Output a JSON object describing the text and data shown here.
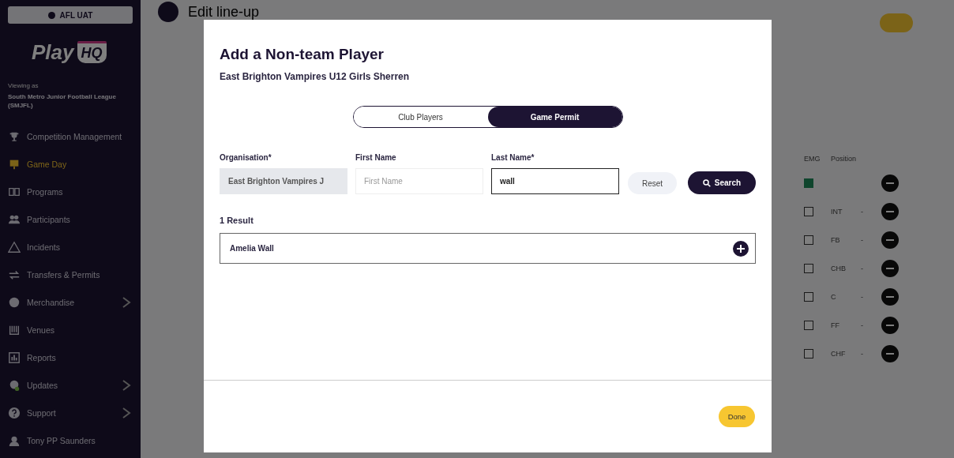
{
  "sidebar": {
    "environment": "AFL UAT",
    "logo_word": "Play",
    "logo_badge": "HQ",
    "viewing_label": "Viewing as",
    "organisation": "South Metro Junior Football League (SMJFL)",
    "items": [
      {
        "label": "Competition Management",
        "selected": false,
        "has_submenu": false
      },
      {
        "label": "Game Day",
        "selected": true,
        "has_submenu": false
      },
      {
        "label": "Programs",
        "selected": false,
        "has_submenu": false
      },
      {
        "label": "Participants",
        "selected": false,
        "has_submenu": false
      },
      {
        "label": "Incidents",
        "selected": false,
        "has_submenu": false
      },
      {
        "label": "Transfers & Permits",
        "selected": false,
        "has_submenu": false
      },
      {
        "label": "Merchandise",
        "selected": false,
        "has_submenu": true
      },
      {
        "label": "Venues",
        "selected": false,
        "has_submenu": false
      },
      {
        "label": "Reports",
        "selected": false,
        "has_submenu": false
      },
      {
        "label": "Updates",
        "selected": false,
        "has_submenu": true
      },
      {
        "label": "Support",
        "selected": false,
        "has_submenu": true
      },
      {
        "label": "Tony PP Saunders",
        "selected": false,
        "has_submenu": false
      }
    ]
  },
  "page": {
    "title": "Edit line-up",
    "lineup": {
      "columns": [
        "EMG",
        "Position"
      ],
      "rows": [
        {
          "emergency": true,
          "dash": ""
        },
        {
          "emergency": false,
          "position": "INT",
          "dash": "-"
        },
        {
          "emergency": false,
          "position": "FB",
          "dash": "-"
        },
        {
          "emergency": false,
          "position": "CHB",
          "dash": "-"
        },
        {
          "emergency": false,
          "position": "C",
          "dash": "-"
        },
        {
          "emergency": false,
          "position": "FF",
          "dash": "-"
        },
        {
          "emergency": false,
          "position": "CHF",
          "dash": "-"
        }
      ]
    }
  },
  "modal": {
    "title": "Add a Non-team Player",
    "subtitle": "East Brighton Vampires U12 Girls Sherren",
    "toggle": [
      {
        "label": "Club Players",
        "selected": false
      },
      {
        "label": "Game Permit",
        "selected": true
      }
    ],
    "fields": [
      {
        "label": "Organisation*",
        "value": "East Brighton Vampires J",
        "disabled": true,
        "focused": false
      },
      {
        "label": "First Name",
        "placeholder": "First Name",
        "disabled": false,
        "focused": false
      },
      {
        "label": "Last Name*",
        "value": "wall",
        "disabled": false,
        "focused": true
      }
    ],
    "reset": "Reset",
    "search": "Search",
    "result_count": "1 Result",
    "results": [
      {
        "name": "Amelia Wall"
      }
    ],
    "done": "Done"
  }
}
